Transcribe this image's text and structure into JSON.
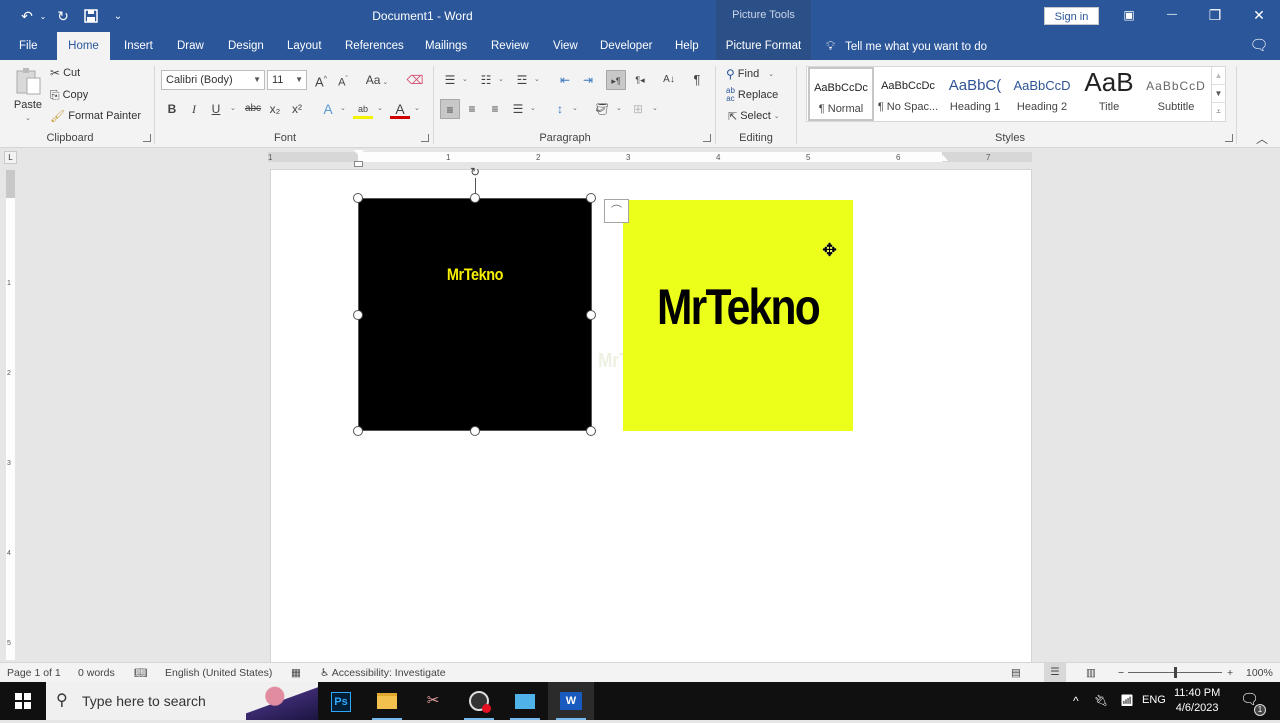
{
  "titlebar": {
    "document_title": "Document1 - Word",
    "contextual_tab_group": "Picture Tools",
    "sign_in": "Sign in",
    "qat": {
      "undo_icon": "↶",
      "redo_icon": "↻",
      "save_icon": "💾",
      "customize_icon": "⌄"
    },
    "window_controls": {
      "ribbon_display": "▣",
      "minimize": "—",
      "restore": "❐",
      "close": "✕"
    }
  },
  "tabs": [
    {
      "label": "File"
    },
    {
      "label": "Home",
      "active": true
    },
    {
      "label": "Insert"
    },
    {
      "label": "Draw"
    },
    {
      "label": "Design"
    },
    {
      "label": "Layout"
    },
    {
      "label": "References"
    },
    {
      "label": "Mailings"
    },
    {
      "label": "Review"
    },
    {
      "label": "View"
    },
    {
      "label": "Developer"
    },
    {
      "label": "Help"
    },
    {
      "label": "Picture Format"
    }
  ],
  "tell_me": "Tell me what you want to do",
  "ribbon": {
    "clipboard": {
      "label": "Clipboard",
      "paste": "Paste",
      "cut": "Cut",
      "copy": "Copy",
      "format_painter": "Format Painter"
    },
    "font": {
      "label": "Font",
      "font_name": "Calibri (Body)",
      "font_size": "11",
      "grow": "A˄",
      "shrink": "A˅",
      "change_case": "Aa",
      "bold": "B",
      "italic": "I",
      "underline": "U",
      "strikethrough": "abc",
      "subscript": "x₂",
      "superscript": "x²",
      "text_effects": "A",
      "highlight": "ab",
      "font_color": "A",
      "highlight_color": "#f3f300",
      "font_color_value": "#d00000"
    },
    "paragraph": {
      "label": "Paragraph",
      "pilcrow": "¶",
      "sort": "A↓"
    },
    "editing": {
      "label": "Editing",
      "find": "Find",
      "replace": "Replace",
      "select": "Select"
    },
    "styles": {
      "label": "Styles",
      "items": [
        {
          "preview": "AaBbCcDc",
          "name": "¶ Normal",
          "selected": true
        },
        {
          "preview": "AaBbCcDc",
          "name": "¶ No Spac..."
        },
        {
          "preview": "AaBbC(",
          "name": "Heading 1"
        },
        {
          "preview": "AaBbCcD",
          "name": "Heading 2"
        },
        {
          "preview": "AaB",
          "name": "Title"
        },
        {
          "preview": "AaBbCcD",
          "name": "Subtitle"
        }
      ]
    }
  },
  "ruler": {
    "horizontal_labels": [
      "1",
      "1",
      "2",
      "3",
      "4",
      "5",
      "6",
      "7"
    ],
    "vertical_labels": [
      "1",
      "2",
      "3",
      "4",
      "5"
    ],
    "tab_selector": "L"
  },
  "document": {
    "image1": {
      "text": "MrTekno",
      "background": "#000000",
      "text_color": "#f7f000",
      "selected": true
    },
    "image2": {
      "text": "MrTekno",
      "background": "#ebff1a",
      "text_color": "#000000"
    },
    "ghost_text": "MrTekno"
  },
  "statusbar": {
    "page": "Page 1 of 1",
    "words": "0 words",
    "language": "English (United States)",
    "accessibility": "Accessibility: Investigate",
    "zoom": "100%",
    "zoom_minus": "−",
    "zoom_plus": "+"
  },
  "taskbar": {
    "search_placeholder": "Type here to search",
    "apps": [
      {
        "name": "Photoshop",
        "glyph": "Ps"
      },
      {
        "name": "File Explorer",
        "glyph": "📁"
      },
      {
        "name": "Snipping",
        "glyph": "✂"
      },
      {
        "name": "OBS",
        "glyph": "◉"
      },
      {
        "name": "Magnifier",
        "glyph": "🔍"
      },
      {
        "name": "Word",
        "glyph": "W"
      }
    ],
    "tray": {
      "chevron": "^",
      "language": "ENG"
    },
    "clock": {
      "time": "11:40 PM",
      "date": "4/6/2023"
    },
    "notifications_count": "1"
  }
}
